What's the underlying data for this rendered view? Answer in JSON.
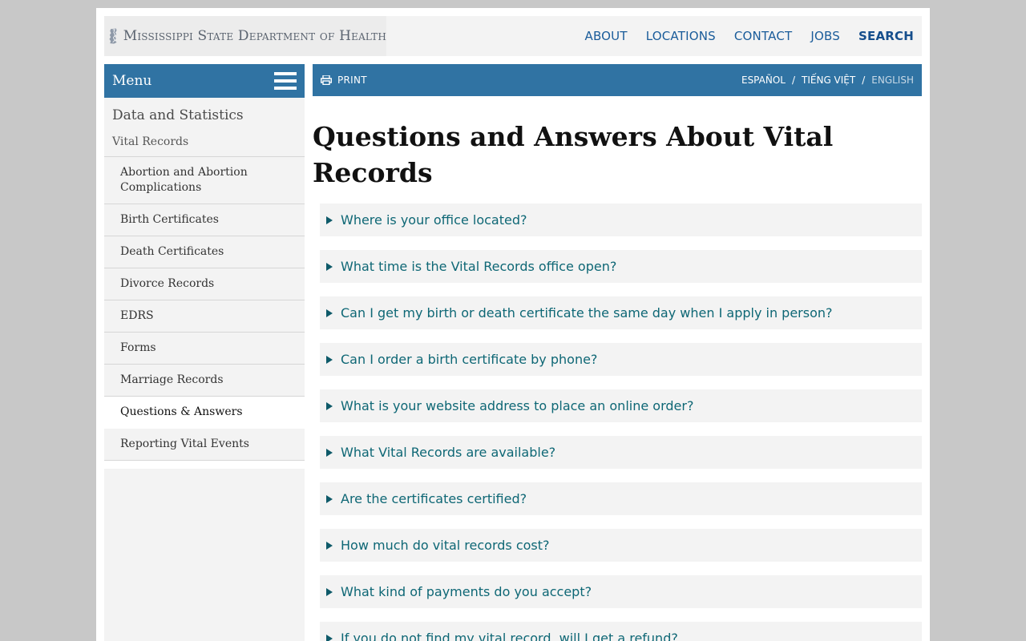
{
  "header": {
    "logo_text": "Mississippi State Department of Health",
    "nav": [
      {
        "label": "ABOUT"
      },
      {
        "label": "LOCATIONS"
      },
      {
        "label": "CONTACT"
      },
      {
        "label": "JOBS"
      },
      {
        "label": "SEARCH"
      }
    ]
  },
  "sidebar": {
    "menu_label": "Menu",
    "section": "Data and Statistics",
    "parent": "Vital Records",
    "items": [
      {
        "label": "Abortion and Abortion Complications"
      },
      {
        "label": "Birth Certificates"
      },
      {
        "label": "Death Certificates"
      },
      {
        "label": "Divorce Records"
      },
      {
        "label": "EDRS"
      },
      {
        "label": "Forms"
      },
      {
        "label": "Marriage Records"
      },
      {
        "label": "Questions & Answers"
      },
      {
        "label": "Reporting Vital Events"
      }
    ]
  },
  "utility": {
    "print_label": "PRINT",
    "languages": [
      {
        "label": "ESPAÑOL"
      },
      {
        "label": "TIẾNG VIỆT"
      },
      {
        "label": "ENGLISH"
      }
    ],
    "separator": "/"
  },
  "main": {
    "title": "Questions and Answers About Vital Records",
    "questions": [
      {
        "q": "Where is your office located?"
      },
      {
        "q": "What time is the Vital Records office open?"
      },
      {
        "q": "Can I get my birth or death certificate the same day when I apply in person?"
      },
      {
        "q": "Can I order a birth certificate by phone?"
      },
      {
        "q": "What is your website address to place an online order?"
      },
      {
        "q": "What Vital Records are available?"
      },
      {
        "q": "Are the certificates certified?"
      },
      {
        "q": "How much do vital records cost?"
      },
      {
        "q": "What kind of payments do you accept?"
      },
      {
        "q": "If you do not find my vital record, will I get a refund?"
      }
    ]
  },
  "colors": {
    "brand_blue": "#3073a3",
    "link_teal": "#0e6775",
    "nav_blue": "#1a5c9a"
  }
}
